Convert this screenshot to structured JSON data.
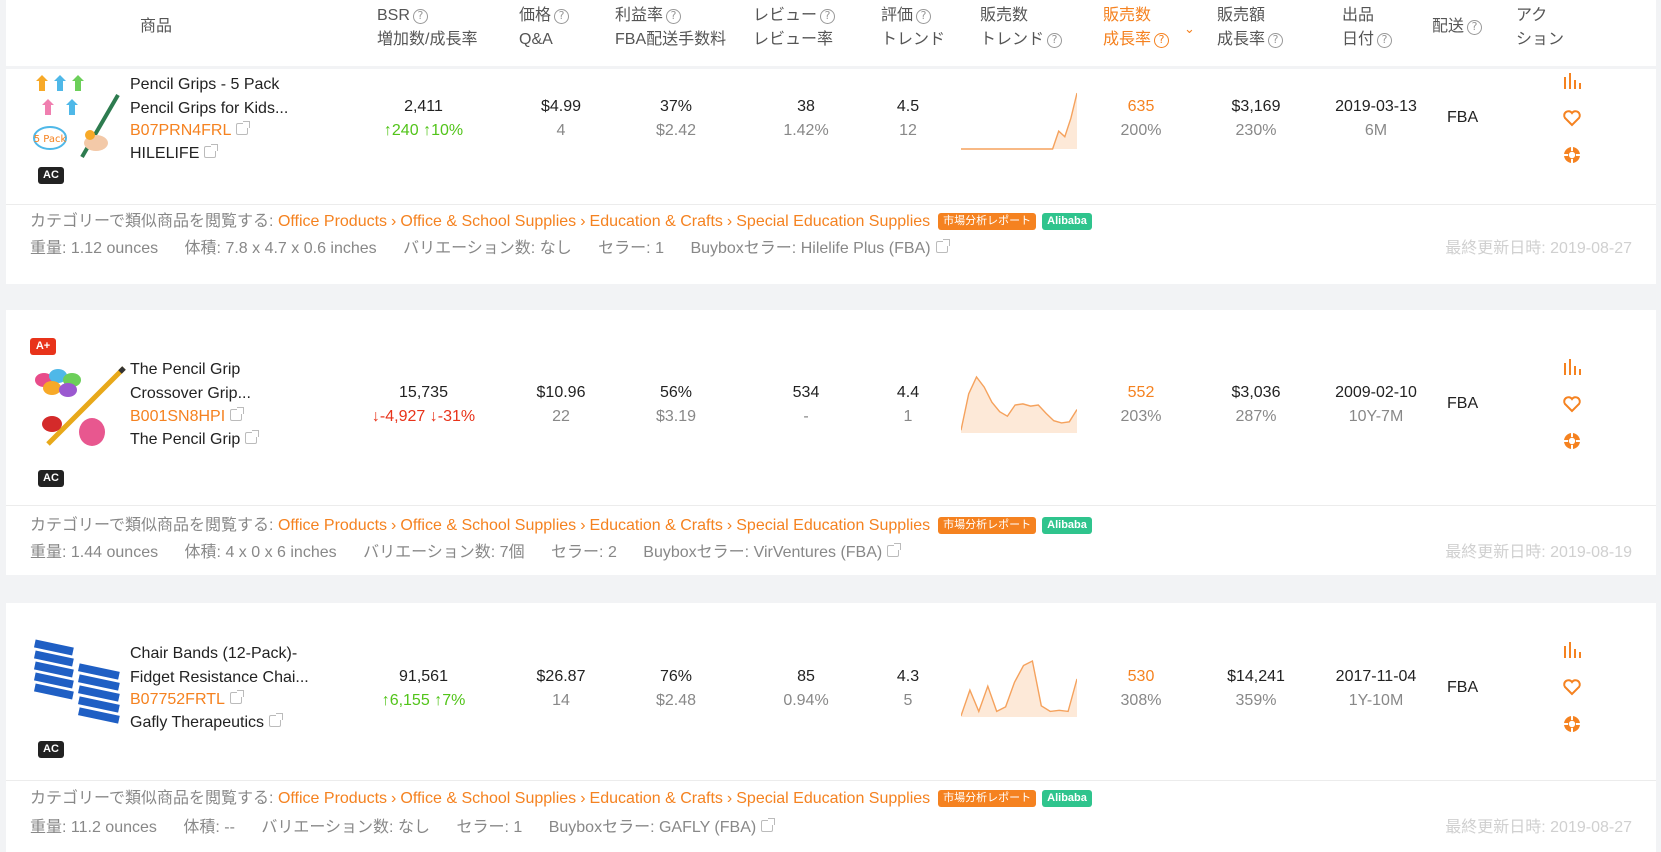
{
  "header": {
    "col_product": "商品",
    "col_bsr_1": "BSR",
    "col_bsr_2": "増加数/成長率",
    "col_price_1": "価格",
    "col_price_2": "Q&A",
    "col_margin_1": "利益率",
    "col_margin_2": "FBA配送手数料",
    "col_review_1": "レビュー",
    "col_review_2": "レビュー率",
    "col_rating_1": "評価",
    "col_rating_2": "トレンド",
    "col_sales_1": "販売数",
    "col_sales_2": "トレンド",
    "col_salesgrowth_1": "販売数",
    "col_salesgrowth_2": "成長率",
    "col_revenue_1": "販売額",
    "col_revenue_2": "成長率",
    "col_date_1": "出品",
    "col_date_2": "日付",
    "col_ship": "配送",
    "col_action_1": "アク",
    "col_action_2": "ション",
    "help_glyph": "?",
    "sort_glyph": "⌄"
  },
  "labels": {
    "category_prefix": "カテゴリーで類似商品を閲覧する:",
    "report_tag": "市場分析レポート",
    "alibaba_tag": "Alibaba",
    "weight": "重量:",
    "volume": "体積:",
    "variations": "バリエーション数:",
    "sellers": "セラー:",
    "buybox": "Buyboxセラー:",
    "updated": "最終更新日時:",
    "category_sep": "›",
    "up_arrow": "↑",
    "down_arrow": "↓"
  },
  "colors": {
    "accent": "#f58220",
    "up": "#52c41a",
    "down": "#e8331a",
    "alibaba": "#2fc48d"
  },
  "products": [
    {
      "title_line1": "Pencil Grips - 5 Pack",
      "title_line2": "Pencil Grips for Kids...",
      "asin": "B07PRN4FRL",
      "brand": "HILELIFE",
      "badge_top": "",
      "badge_bottom": "AC",
      "bsr": "2,411",
      "bsr_change": "240",
      "bsr_rate": "10%",
      "bsr_direction": "up",
      "price": "$4.99",
      "qa": "4",
      "margin": "37%",
      "fba_fee": "$2.42",
      "reviews": "38",
      "review_rate": "1.42%",
      "rating": "4.5",
      "rating_trend": "12",
      "sales_trend": [
        0,
        0,
        0,
        0,
        0,
        0,
        0,
        0,
        0,
        0,
        0,
        0,
        0,
        0,
        0,
        0,
        0.32,
        0.22,
        0.55,
        1.0
      ],
      "sales_growth": "635",
      "sales_growth_rate": "200%",
      "revenue": "$3,169",
      "revenue_rate": "230%",
      "listing_date": "2019-03-13",
      "listing_age": "6M",
      "shipping": "FBA",
      "categories": [
        "Office Products",
        "Office & School Supplies",
        "Education & Crafts",
        "Special Education Supplies"
      ],
      "weight": "1.12 ounces",
      "volume": "7.8 x 4.7 x 0.6 inches",
      "variations": "なし",
      "sellers": "1",
      "buybox": "Hilelife Plus (FBA)",
      "updated": "2019-08-27"
    },
    {
      "title_line1": "The Pencil Grip",
      "title_line2": "Crossover Grip...",
      "asin": "B001SN8HPI",
      "brand": "The Pencil Grip",
      "badge_top": "A+",
      "badge_bottom": "AC",
      "bsr": "15,735",
      "bsr_change": "-4,927",
      "bsr_rate": "-31%",
      "bsr_direction": "down",
      "price": "$10.96",
      "qa": "22",
      "margin": "56%",
      "fba_fee": "$3.19",
      "reviews": "534",
      "review_rate": "-",
      "rating": "4.4",
      "rating_trend": "1",
      "sales_trend": [
        0.05,
        0.7,
        1.0,
        0.82,
        0.55,
        0.38,
        0.3,
        0.5,
        0.52,
        0.48,
        0.5,
        0.35,
        0.22,
        0.18,
        0.2,
        0.42
      ],
      "sales_growth": "552",
      "sales_growth_rate": "203%",
      "revenue": "$3,036",
      "revenue_rate": "287%",
      "listing_date": "2009-02-10",
      "listing_age": "10Y-7M",
      "shipping": "FBA",
      "categories": [
        "Office Products",
        "Office & School Supplies",
        "Education & Crafts",
        "Special Education Supplies"
      ],
      "weight": "1.44 ounces",
      "volume": "4 x 0 x 6 inches",
      "variations": "7個",
      "sellers": "2",
      "buybox": "VirVentures (FBA)",
      "updated": "2019-08-19"
    },
    {
      "title_line1": "Chair Bands (12-Pack)-",
      "title_line2": "Fidget Resistance Chai...",
      "asin": "B07752FRTL",
      "brand": "Gafly Therapeutics",
      "badge_top": "",
      "badge_bottom": "AC",
      "bsr": "91,561",
      "bsr_change": "6,155",
      "bsr_rate": "7%",
      "bsr_direction": "up",
      "price": "$26.87",
      "qa": "14",
      "margin": "76%",
      "fba_fee": "$2.48",
      "reviews": "85",
      "review_rate": "0.94%",
      "rating": "4.3",
      "rating_trend": "5",
      "sales_trend": [
        0.02,
        0.48,
        0.1,
        0.55,
        0.1,
        0.18,
        0.62,
        0.92,
        1.0,
        0.2,
        0.1,
        0.12,
        0.1,
        0.68
      ],
      "sales_growth": "530",
      "sales_growth_rate": "308%",
      "revenue": "$14,241",
      "revenue_rate": "359%",
      "listing_date": "2017-11-04",
      "listing_age": "1Y-10M",
      "shipping": "FBA",
      "categories": [
        "Office Products",
        "Office & School Supplies",
        "Education & Crafts",
        "Special Education Supplies"
      ],
      "weight": "11.2 ounces",
      "volume": "--",
      "variations": "なし",
      "sellers": "1",
      "buybox": "GAFLY (FBA)",
      "updated": "2019-08-27"
    }
  ]
}
